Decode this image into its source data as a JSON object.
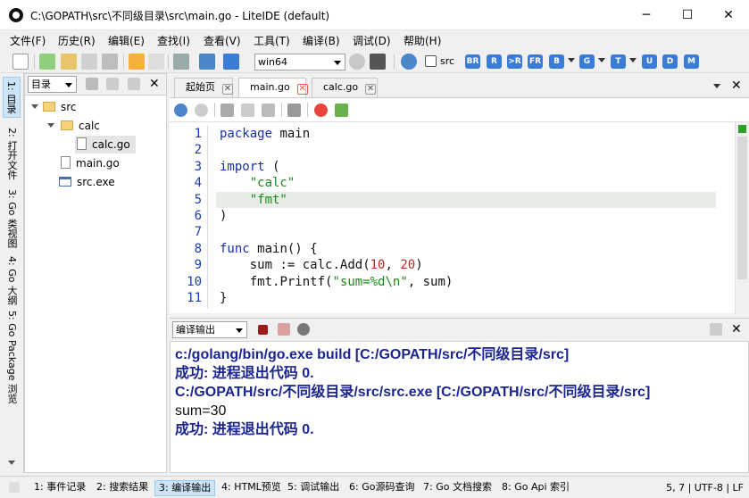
{
  "window": {
    "title": "C:\\GOPATH\\src\\不同级目录\\src\\main.go - LiteIDE (default)",
    "minimize": "─",
    "maximize": "☐",
    "close": "✕"
  },
  "menu": [
    "文件(F)",
    "历史(R)",
    "编辑(E)",
    "查找(I)",
    "查看(V)",
    "工具(T)",
    "编译(B)",
    "调试(D)",
    "帮助(H)"
  ],
  "toolbar": {
    "env_selected": "win64",
    "src_checkbox_label": "src",
    "badges": [
      "BR",
      "R",
      ">R",
      "FR",
      "B",
      "G",
      "T",
      "U",
      "D",
      "M"
    ]
  },
  "left_tabs": [
    "1: 目录",
    "2: 打开文件",
    "3: Go 类视图",
    "4: Go 大纲",
    "5: Go Package 浏览"
  ],
  "file_panel": {
    "combo": "目录",
    "tree": [
      {
        "label": "src",
        "type": "folder",
        "level": 0
      },
      {
        "label": "calc",
        "type": "folder",
        "level": 1
      },
      {
        "label": "calc.go",
        "type": "file",
        "level": 2
      },
      {
        "label": "main.go",
        "type": "file",
        "level": 1
      },
      {
        "label": "src.exe",
        "type": "exe",
        "level": 1
      }
    ]
  },
  "editor": {
    "tabs": [
      {
        "label": "起始页",
        "active": false
      },
      {
        "label": "main.go",
        "active": true
      },
      {
        "label": "calc.go",
        "active": false
      }
    ],
    "current_line": 5,
    "lines": [
      {
        "no": "1",
        "text": "package main"
      },
      {
        "no": "2",
        "text": ""
      },
      {
        "no": "3",
        "text": "import ("
      },
      {
        "no": "4",
        "text": "    \"calc\""
      },
      {
        "no": "5",
        "text": "    \"fmt\""
      },
      {
        "no": "6",
        "text": ")"
      },
      {
        "no": "7",
        "text": ""
      },
      {
        "no": "8",
        "text": "func main() {"
      },
      {
        "no": "9",
        "text": "    sum := calc.Add(10, 20)"
      },
      {
        "no": "10",
        "text": "    fmt.Printf(\"sum=%d\\n\", sum)"
      },
      {
        "no": "11",
        "text": "}"
      }
    ]
  },
  "output": {
    "combo": "编译输出",
    "lines": [
      {
        "text": "c:/golang/bin/go.exe build [C:/GOPATH/src/不同级目录/src]",
        "bold": true
      },
      {
        "text": "成功: 进程退出代码 0.",
        "bold": true
      },
      {
        "text": "C:/GOPATH/src/不同级目录/src/src.exe  [C:/GOPATH/src/不同级目录/src]",
        "bold": true
      },
      {
        "text": "sum=30",
        "bold": false
      },
      {
        "text": "成功: 进程退出代码 0.",
        "bold": true
      }
    ]
  },
  "bottom_tabs": [
    "1: 事件记录",
    "2: 搜索结果",
    "3: 编译输出",
    "4: HTML预览",
    "5: 调试输出",
    "6: Go源码查询",
    "7: Go 文档搜索",
    "8: Go Api 索引"
  ],
  "status": "5, 7 | UTF-8 | LF",
  "colors": {
    "keyword": "#1a2dad",
    "string": "#1a8a18",
    "number": "#b8291f",
    "output_text": "#1b2590"
  }
}
